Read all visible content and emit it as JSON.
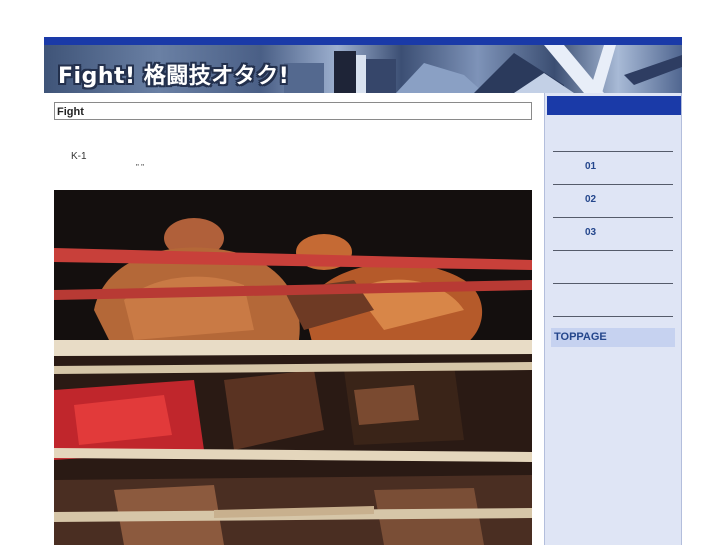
{
  "header": {
    "title": "Fight! 格闘技オタク!"
  },
  "main": {
    "heading": "Fight",
    "body_text": "K-1",
    "quote_marks": "\" \""
  },
  "sidebar": {
    "links": [
      {
        "label": "01"
      },
      {
        "label": "02"
      },
      {
        "label": "03"
      }
    ],
    "toppage_label": "TOPPAGE"
  },
  "colors": {
    "accent": "#1a3aa8",
    "sidebar_bg": "#dfe5f5",
    "link": "#24468c"
  }
}
